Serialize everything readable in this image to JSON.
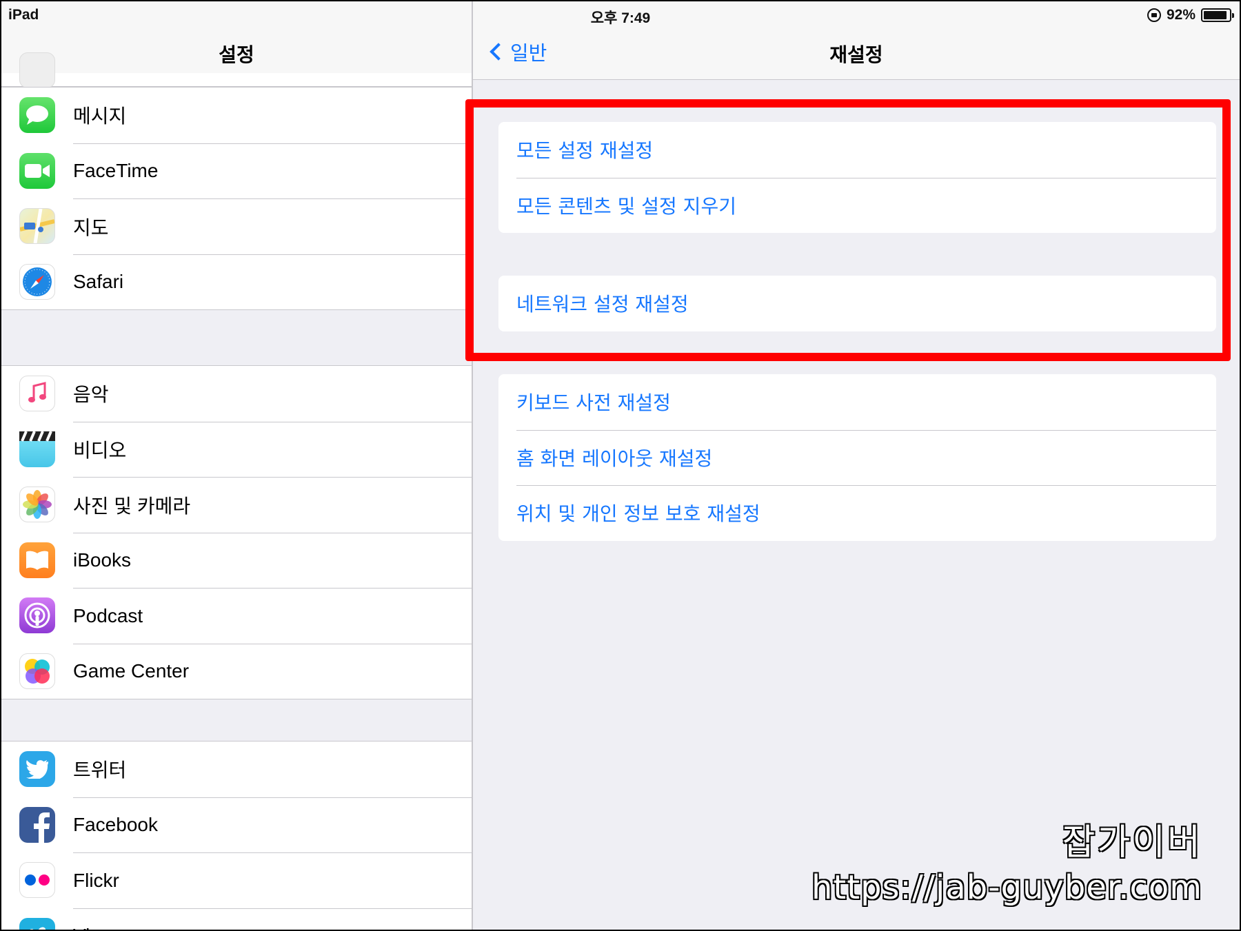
{
  "status_bar": {
    "device": "iPad",
    "time": "오후 7:49",
    "battery": "92%",
    "battery_level": 0.92
  },
  "left_pane": {
    "title": "설정",
    "groups": [
      {
        "items": [
          {
            "label": "메시지",
            "icon": "messages-icon"
          },
          {
            "label": "FaceTime",
            "icon": "facetime-icon"
          },
          {
            "label": "지도",
            "icon": "maps-icon"
          },
          {
            "label": "Safari",
            "icon": "safari-icon"
          }
        ]
      },
      {
        "items": [
          {
            "label": "음악",
            "icon": "music-icon"
          },
          {
            "label": "비디오",
            "icon": "videos-icon"
          },
          {
            "label": "사진 및 카메라",
            "icon": "photos-icon"
          },
          {
            "label": "iBooks",
            "icon": "ibooks-icon"
          },
          {
            "label": "Podcast",
            "icon": "podcast-icon"
          },
          {
            "label": "Game Center",
            "icon": "game-center-icon"
          }
        ]
      },
      {
        "items": [
          {
            "label": "트위터",
            "icon": "twitter-icon"
          },
          {
            "label": "Facebook",
            "icon": "facebook-icon"
          },
          {
            "label": "Flickr",
            "icon": "flickr-icon"
          },
          {
            "label": "Vimeo",
            "icon": "vimeo-icon"
          }
        ]
      }
    ]
  },
  "right_pane": {
    "back_label": "일반",
    "title": "재설정",
    "groups": [
      {
        "items": [
          "모든 설정 재설정",
          "모든 콘텐츠 및 설정 지우기"
        ]
      },
      {
        "items": [
          "네트워크 설정 재설정"
        ]
      },
      {
        "items": [
          "키보드 사전 재설정",
          "홈 화면 레이아웃 재설정",
          "위치 및 개인 정보 보호 재설정"
        ]
      }
    ]
  },
  "watermark": {
    "name": "잡가이버",
    "url": "https://jab-guyber.com"
  },
  "colors": {
    "accent": "#1677ff",
    "highlight": "#ff0000",
    "background": "#efeff4"
  }
}
